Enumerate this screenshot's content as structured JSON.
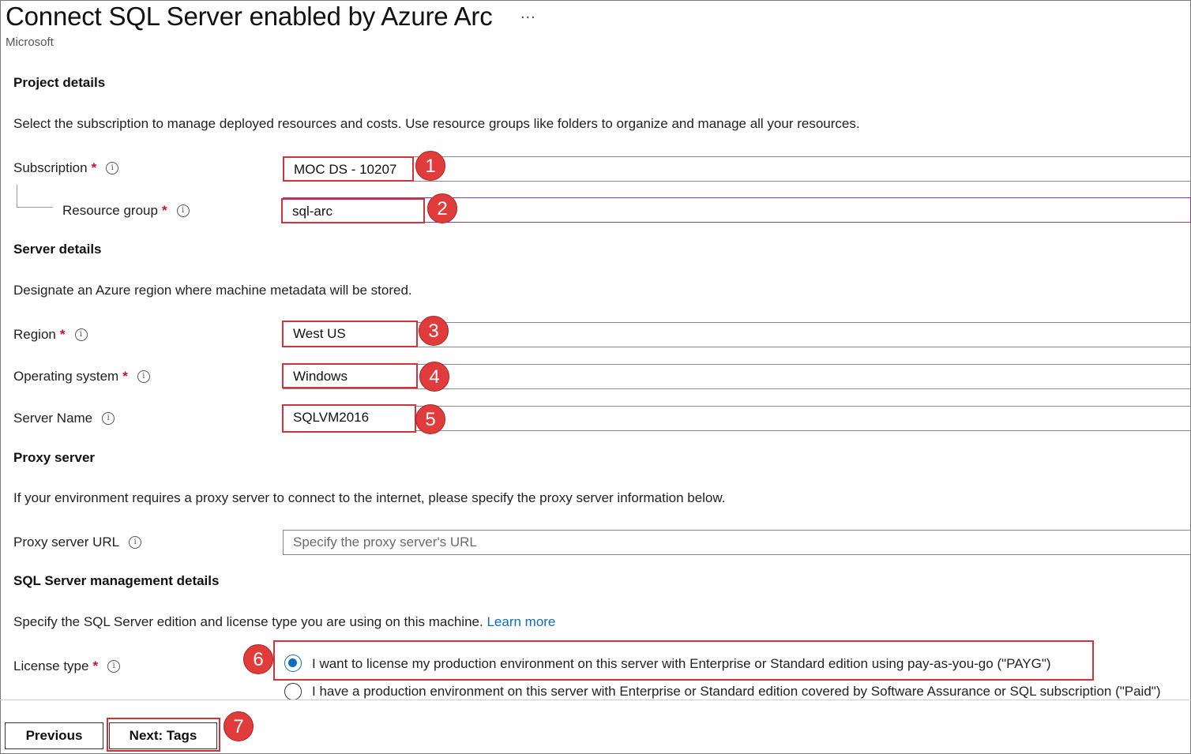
{
  "header": {
    "title": "Connect SQL Server enabled by Azure Arc",
    "more_icon": "...",
    "publisher": "Microsoft"
  },
  "project": {
    "heading": "Project details",
    "description": "Select the subscription to manage deployed resources and costs. Use resource groups like folders to organize and manage all your resources.",
    "subscription": {
      "label": "Subscription",
      "required": "*",
      "value": "MOC DS - 10207",
      "badge": "1"
    },
    "resource_group": {
      "label": "Resource group",
      "required": "*",
      "value": "sql-arc",
      "badge": "2"
    }
  },
  "server": {
    "heading": "Server details",
    "description": "Designate an Azure region where machine metadata will be stored.",
    "region": {
      "label": "Region",
      "required": "*",
      "value": "West US",
      "badge": "3"
    },
    "os": {
      "label": "Operating system",
      "required": "*",
      "value": "Windows",
      "badge": "4"
    },
    "name": {
      "label": "Server Name",
      "value": "SQLVM2016",
      "badge": "5"
    }
  },
  "proxy": {
    "heading": "Proxy server",
    "description": "If your environment requires a proxy server to connect to the internet, please specify the proxy server information below.",
    "url_label": "Proxy server URL",
    "url_placeholder": "Specify the proxy server's URL"
  },
  "sql_mgmt": {
    "heading": "SQL Server management details",
    "description": "Specify the SQL Server edition and license type you are using on this machine.",
    "learn_more": "Learn more",
    "license_label": "License type",
    "required": "*",
    "badge": "6",
    "options": [
      {
        "label": "I want to license my production environment on this server with Enterprise or Standard edition using pay-as-you-go (\"PAYG\")",
        "selected": true
      },
      {
        "label": "I have a production environment on this server with Enterprise or Standard edition covered by Software Assurance or SQL subscription (\"Paid\")",
        "selected": false
      }
    ]
  },
  "footer": {
    "previous": "Previous",
    "next": "Next: Tags",
    "badge": "7"
  },
  "colors": {
    "accent": "#0f6cbd",
    "annotation_red": "#d13438",
    "required": "#c8102e"
  },
  "icons": {
    "info": "info-icon"
  }
}
